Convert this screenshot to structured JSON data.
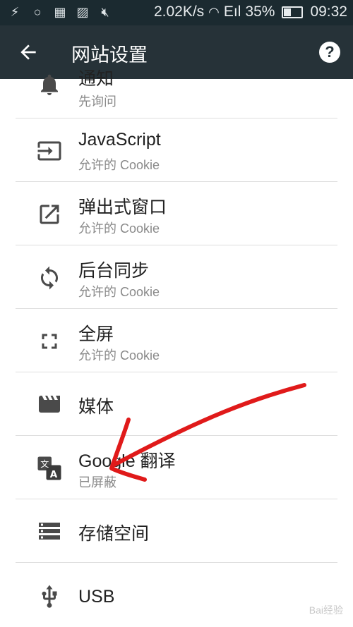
{
  "status_bar": {
    "network_speed": "2.02K/s",
    "signal": "Eıl",
    "battery_percent": "35%",
    "time": "09:32",
    "icons": [
      "charging-icon",
      "search-icon",
      "apps-icon",
      "image-icon",
      "mute-icon",
      "wifi-icon",
      "signal-icon",
      "battery-icon"
    ]
  },
  "app_bar": {
    "title": "网站设置",
    "help": "?"
  },
  "items": [
    {
      "title": "通知",
      "subtitle": "先询问",
      "icon": "bell-icon"
    },
    {
      "title": "JavaScript",
      "subtitle": "允许的 Cookie",
      "icon": "javascript-icon"
    },
    {
      "title": "弹出式窗口",
      "subtitle": "允许的 Cookie",
      "icon": "popup-icon"
    },
    {
      "title": "后台同步",
      "subtitle": "允许的 Cookie",
      "icon": "sync-icon"
    },
    {
      "title": "全屏",
      "subtitle": "允许的 Cookie",
      "icon": "fullscreen-icon"
    },
    {
      "title": "媒体",
      "subtitle": "",
      "icon": "media-icon"
    },
    {
      "title": "Google 翻译",
      "subtitle": "已屏蔽",
      "icon": "translate-icon"
    },
    {
      "title": "存储空间",
      "subtitle": "",
      "icon": "storage-icon"
    },
    {
      "title": "USB",
      "subtitle": "",
      "icon": "usb-icon"
    }
  ],
  "colors": {
    "status_bar_bg": "#1b2a30",
    "app_bar_bg": "#263238",
    "icon": "#4a4a4a",
    "annotation": "#e01a1a"
  },
  "watermark": "Bai经验"
}
